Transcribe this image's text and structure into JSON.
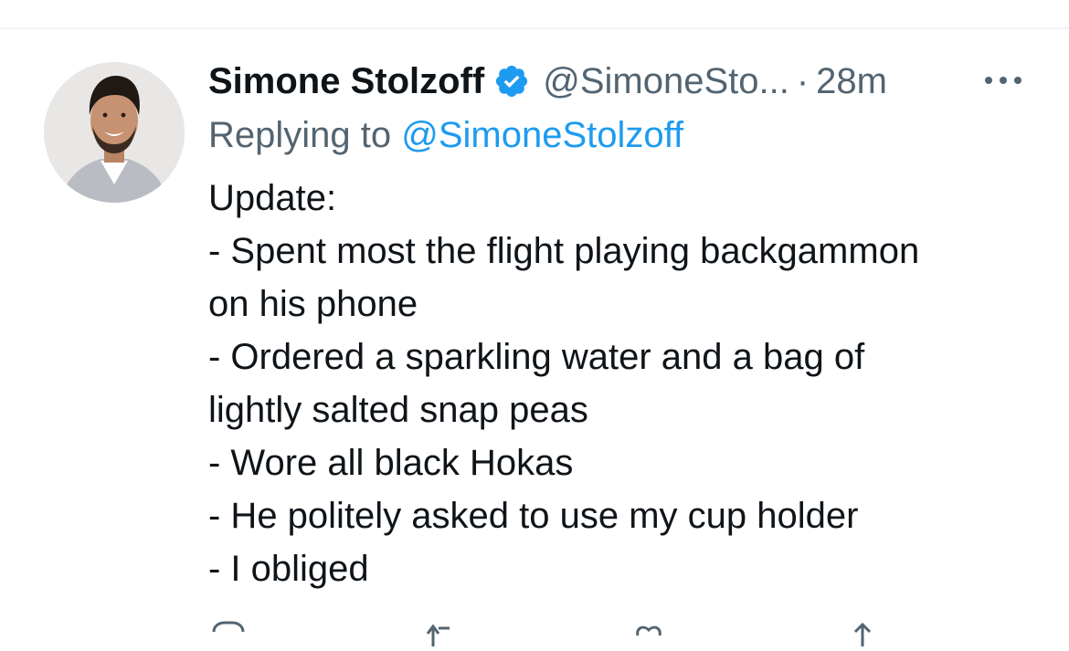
{
  "tweet": {
    "display_name": "Simone Stolzoff",
    "handle": "@SimoneSto...",
    "separator": "·",
    "time": "28m",
    "reply_prefix": "Replying to ",
    "reply_mention": "@SimoneStolzoff",
    "body_lines": [
      "Update:",
      "- Spent most the flight playing backgammon",
      "on his phone",
      "- Ordered a sparkling water and a bag of",
      "lightly salted snap peas",
      "- Wore all black Hokas",
      "- He politely asked to use my cup holder",
      "- I obliged"
    ]
  },
  "icons": {
    "verified": "verified-badge-icon",
    "more": "more-options-icon",
    "reply": "reply-icon",
    "retweet": "retweet-icon",
    "like": "like-icon",
    "share": "share-icon"
  },
  "colors": {
    "text_primary": "#0f1419",
    "text_secondary": "#536471",
    "accent": "#1d9bf0",
    "divider": "#eff3f4"
  }
}
